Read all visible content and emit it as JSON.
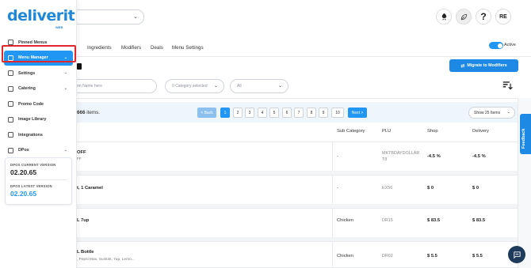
{
  "brand": {
    "logo": "deliverit",
    "logo_sub": "WEB"
  },
  "sidebar": {
    "items": [
      {
        "label": "Pinned Menus",
        "icon": "pin-icon",
        "chevron": ""
      },
      {
        "label": "Menu Manager",
        "icon": "menu-icon",
        "chevron": "⌄"
      },
      {
        "label": "Settings",
        "icon": "gear-icon",
        "chevron": "⌄"
      },
      {
        "label": "Catering",
        "icon": "catering-icon",
        "chevron": "⌄"
      },
      {
        "label": "Promo Code",
        "icon": "promo-icon",
        "chevron": ""
      },
      {
        "label": "Image Library",
        "icon": "image-icon",
        "chevron": ""
      },
      {
        "label": "Integrations",
        "icon": "integrations-icon",
        "chevron": ""
      },
      {
        "label": "DPos",
        "icon": "pos-icon",
        "chevron": "⌄"
      }
    ],
    "version": {
      "current_label": "DPOS CURRENT VERSION",
      "current_value": "02.20.65",
      "latest_label": "DPOS LATEST VERSION",
      "latest_value": "02.20.65"
    }
  },
  "header": {
    "avatar": "RE",
    "help": "?"
  },
  "tabs": {
    "items": [
      "Ingredients",
      "Modifiers",
      "Deals",
      "Menu Settings"
    ],
    "active_label": "Active"
  },
  "toolbar": {
    "migrate_label": "Migrate to Modifiers",
    "search_placeholder": "Item Name here",
    "category_placeholder": "0 Category selected",
    "all_placeholder": "All"
  },
  "pager": {
    "count_prefix": "666",
    "count_suffix": " items.",
    "back": "< Back",
    "pages": [
      "1",
      "2",
      "3",
      "4",
      "5",
      "6",
      "7",
      "8",
      "9",
      "10"
    ],
    "next": "Next >",
    "show": "Show 25 Items"
  },
  "table": {
    "columns": [
      "Sub Category",
      "PLU",
      "Shop",
      "Delivery"
    ],
    "rows": [
      {
        "name": "OFF",
        "desc": "FF",
        "sub": "-",
        "plu": "MKTBDAYDOLLAR T8",
        "shop": "-4.5 %",
        "delivery": "-4.5 %"
      },
      {
        "name": "t, 1 Caramel",
        "desc": "",
        "sub": "-",
        "plu": "EX56",
        "shop": "$ 0",
        "delivery": "$ 0"
      },
      {
        "name": "L 7up",
        "desc": "",
        "sub": "Chicken",
        "plu": "DR15",
        "shop": "$ 83.5",
        "delivery": "$ 83.5"
      },
      {
        "name": "L Bottle",
        "desc": ", Pepsi Max, Sunkist, 7up, Lemo...",
        "sub": "Chicken",
        "plu": "DR02",
        "shop": "$ 5.5",
        "delivery": "$ 5.5"
      }
    ]
  },
  "feedback": "Feedback",
  "colors": {
    "accent": "#2196f3",
    "highlight": "#e1262d"
  }
}
